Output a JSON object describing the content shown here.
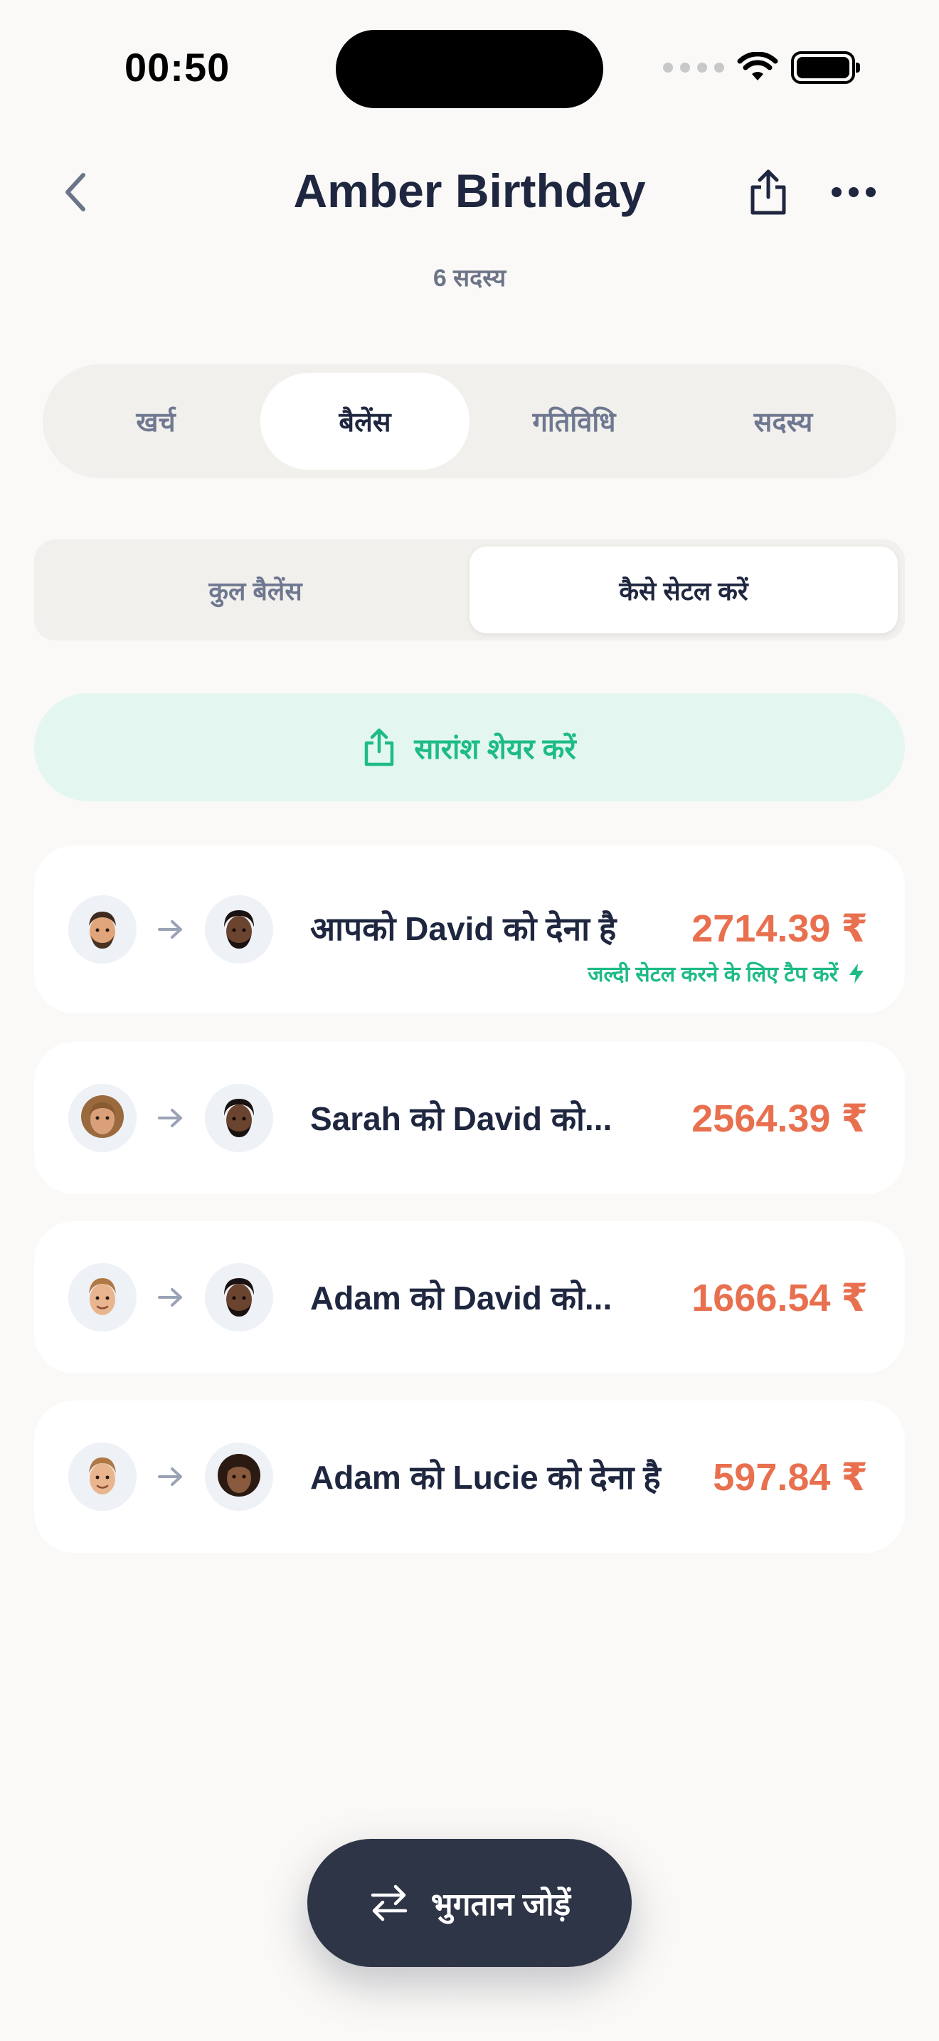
{
  "status_bar": {
    "time": "00:50"
  },
  "header": {
    "title": "Amber Birthday",
    "subtitle": "6 सदस्य"
  },
  "main_tabs": [
    {
      "label": "खर्च",
      "active": false
    },
    {
      "label": "बैलेंस",
      "active": true
    },
    {
      "label": "गतिविधि",
      "active": false
    },
    {
      "label": "सदस्य",
      "active": false
    }
  ],
  "sub_tabs": [
    {
      "label": "कुल बैलेंस",
      "active": false
    },
    {
      "label": "कैसे सेटल करें",
      "active": true
    }
  ],
  "share_summary": {
    "label": "सारांश शेयर करें",
    "icon": "share-icon"
  },
  "settlements": [
    {
      "text": "आपको David को देना है",
      "amount": "2714.39 ₹",
      "hint": "जल्दी सेटल करने के लिए टैप करें"
    },
    {
      "text": "Sarah को David को...",
      "amount": "2564.39 ₹"
    },
    {
      "text": "Adam को David को...",
      "amount": "1666.54 ₹"
    },
    {
      "text": "Adam को Lucie को देना है",
      "amount": "597.84 ₹"
    }
  ],
  "add_payment": {
    "label": "भुगतान जोड़ें",
    "icon": "swap-arrows-icon"
  },
  "colors": {
    "accent_green": "#1EBB87",
    "amount_orange": "#E8704F",
    "dark_button": "#2E3547",
    "background": "#FAF9F7"
  }
}
